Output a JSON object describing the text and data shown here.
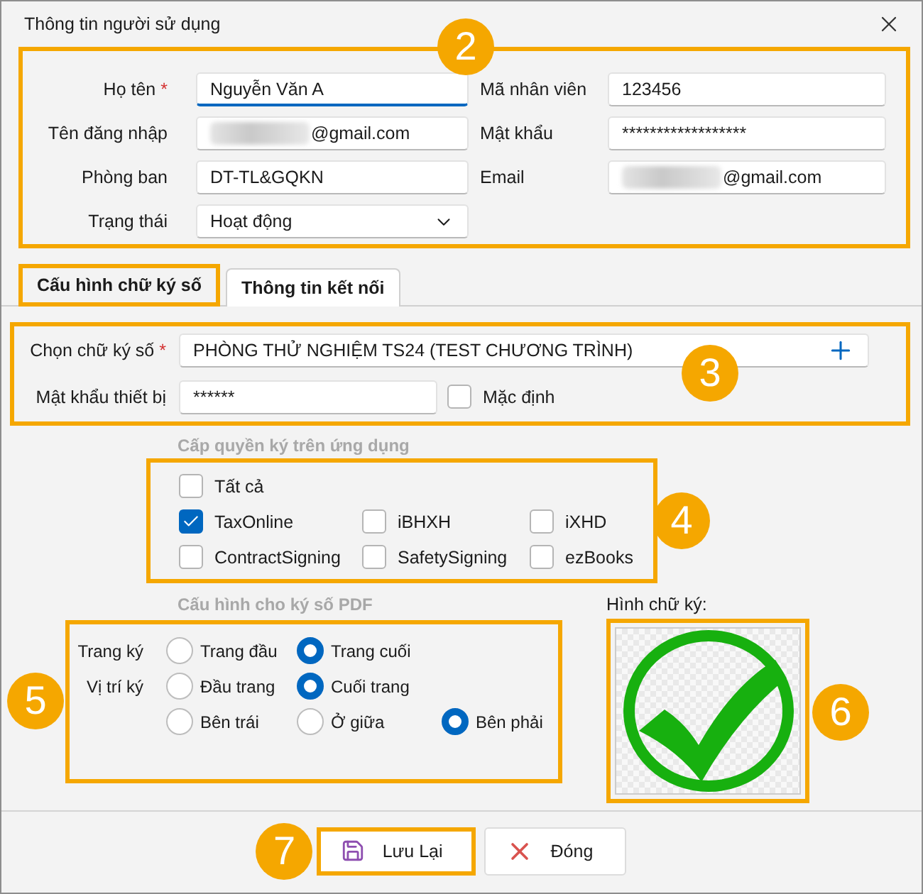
{
  "window": {
    "title": "Thông tin người sử dụng"
  },
  "user_section": {
    "callout": "2",
    "fields": [
      {
        "label": "Họ tên",
        "required_mark": "*",
        "kind": "text",
        "value": "Nguyễn Văn A",
        "focused": true,
        "redacted": false
      },
      {
        "label": "Mã nhân viên",
        "kind": "text",
        "value": "123456",
        "focused": false,
        "redacted": false
      },
      {
        "label": "Tên đăng nhập",
        "kind": "text",
        "value": "@gmail.com",
        "focused": false,
        "redacted": true
      },
      {
        "label": "Mật khẩu",
        "kind": "text",
        "value": "******************",
        "focused": false,
        "redacted": false
      },
      {
        "label": "Phòng ban",
        "kind": "text",
        "value": "DT-TL&GQKN",
        "focused": false,
        "redacted": false
      },
      {
        "label": "Email",
        "kind": "text",
        "value": "@gmail.com",
        "focused": false,
        "redacted": true
      },
      {
        "label": "Trạng thái",
        "kind": "dropdown",
        "value": "Hoạt động"
      }
    ]
  },
  "tabs": [
    {
      "label": "Cấu hình chữ ký số",
      "selected": true,
      "highlighted": true
    },
    {
      "label": "Thông tin kết nối",
      "selected": false,
      "highlighted": false
    }
  ],
  "signature_section": {
    "callout": "3",
    "certificate": {
      "label": "Chọn chữ ký số",
      "required_mark": "*",
      "value": "PHÒNG THỬ NGHIỆM TS24 (TEST CHƯƠNG TRÌNH)"
    },
    "device_password": {
      "label": "Mật khẩu thiết bị",
      "value": "******"
    },
    "default": {
      "label": "Mặc định",
      "checked": false
    }
  },
  "permissions": {
    "title": "Cấp quyền ký trên ứng dụng",
    "callout": "4",
    "items": [
      {
        "label": "Tất cả",
        "kind": "all",
        "checked": false
      },
      {
        "label": "TaxOnline",
        "kind": "app",
        "checked": true
      },
      {
        "label": "iBHXH",
        "kind": "app",
        "checked": false
      },
      {
        "label": "iXHD",
        "kind": "app",
        "checked": false
      },
      {
        "label": "ContractSigning",
        "kind": "app",
        "checked": false
      },
      {
        "label": "SafetySigning",
        "kind": "app",
        "checked": false
      },
      {
        "label": "ezBooks",
        "kind": "app",
        "checked": false
      }
    ]
  },
  "pdf_config": {
    "title": "Cấu hình cho ký số PDF",
    "callout": "5",
    "rows": [
      {
        "label": "Trang ký",
        "options": [
          {
            "label": "Trang đầu",
            "selected": false
          },
          {
            "label": "Trang cuối",
            "selected": true
          }
        ]
      },
      {
        "label": "Vị trí ký",
        "options": [
          {
            "label": "Đầu trang",
            "selected": false
          },
          {
            "label": "Cuối trang",
            "selected": true
          }
        ]
      },
      {
        "options": [
          {
            "label": "Bên trái",
            "selected": false
          },
          {
            "label": "Ở giữa",
            "selected": false
          },
          {
            "label": "Bên phải",
            "selected": true
          }
        ]
      }
    ]
  },
  "signature_image": {
    "label": "Hình chữ ký:",
    "callout": "6"
  },
  "buttons": [
    {
      "label": "Lưu Lại",
      "kind": "save",
      "highlighted": true,
      "callout": "7"
    },
    {
      "label": "Đóng",
      "kind": "close",
      "highlighted": false
    }
  ]
}
